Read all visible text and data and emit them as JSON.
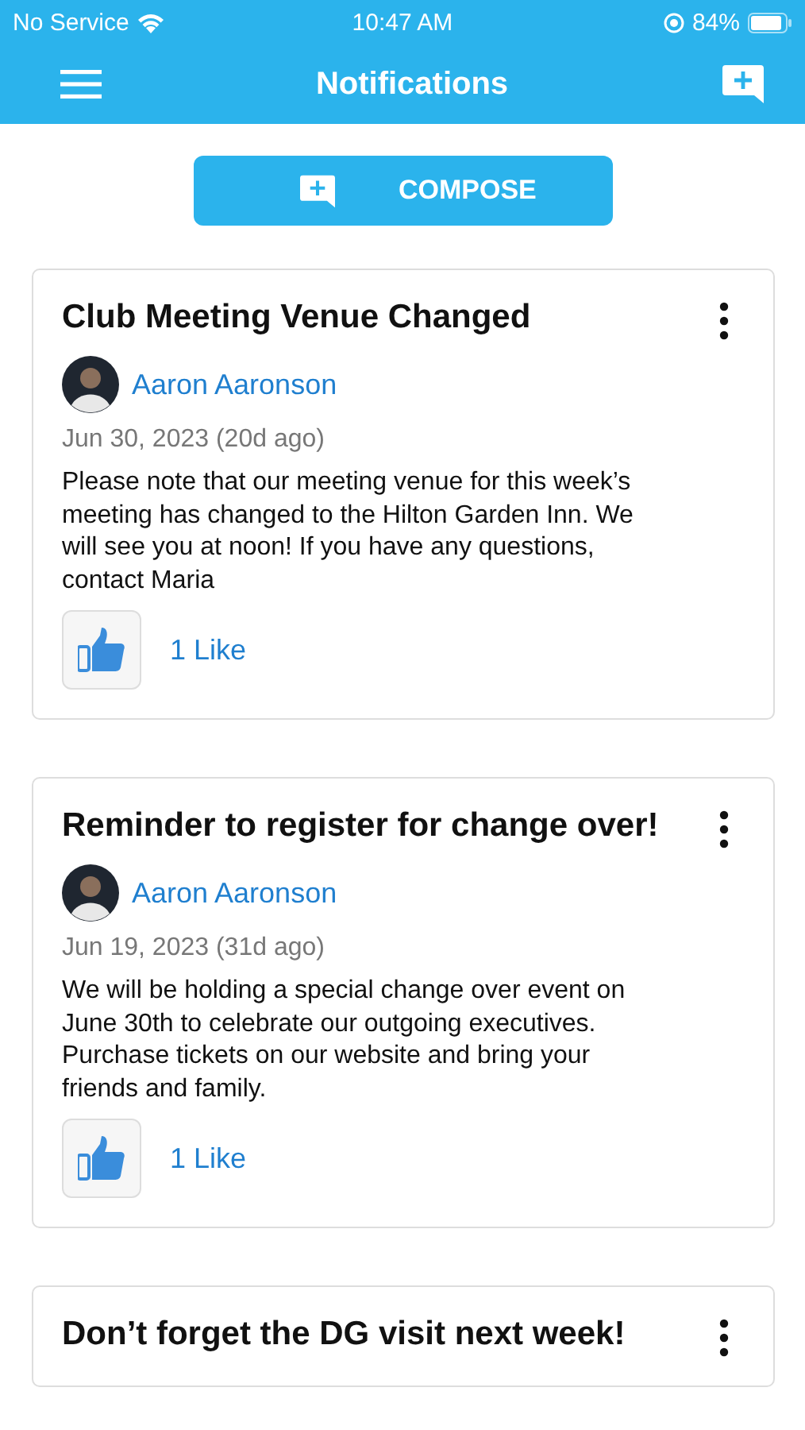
{
  "status_bar": {
    "carrier": "No Service",
    "time": "10:47 AM",
    "battery": "84%"
  },
  "nav": {
    "title": "Notifications"
  },
  "compose_button": {
    "label": "COMPOSE"
  },
  "notifications": [
    {
      "title": "Club Meeting Venue Changed",
      "author": "Aaron Aaronson",
      "date": "Jun 30, 2023 (20d ago)",
      "body": "Please note that our meeting venue for this week’s meeting has changed to the Hilton Garden Inn. We will see you at noon! If you have any questions, contact Maria",
      "likes": "1 Like"
    },
    {
      "title": "Reminder to register for change over!",
      "author": "Aaron Aaronson",
      "date": "Jun 19, 2023 (31d ago)",
      "body": "We will be holding a special change over event on June 30th to celebrate our outgoing executives. Purchase tickets on our website and bring your friends and family.",
      "likes": "1 Like"
    },
    {
      "title": "Don’t forget the DG visit next week!"
    }
  ]
}
